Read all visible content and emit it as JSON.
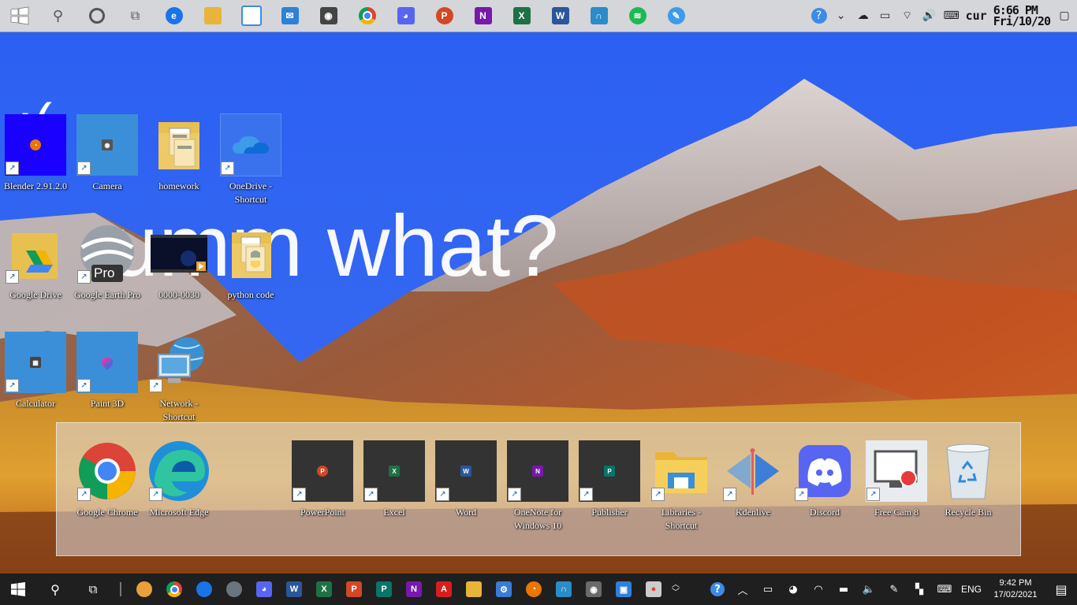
{
  "top_taskbar": {
    "apps": [
      {
        "icon": "windows-start-icon",
        "color": "#ffffff"
      },
      {
        "icon": "search-icon",
        "color": "#555555"
      },
      {
        "icon": "cortana-icon",
        "color": "#555555"
      },
      {
        "icon": "task-view-icon",
        "color": "#555555"
      },
      {
        "icon": "edge-icon",
        "color": "#1a73e8"
      },
      {
        "icon": "file-explorer-icon",
        "color": "#e8b43a"
      },
      {
        "icon": "store-icon",
        "color": "#3a8be8"
      },
      {
        "icon": "mail-icon",
        "color": "#2f80d8"
      },
      {
        "icon": "camera-icon",
        "color": "#444444"
      },
      {
        "icon": "chrome-icon",
        "color": "#db4437"
      },
      {
        "icon": "discord-icon",
        "color": "#5865f2"
      },
      {
        "icon": "powerpoint-icon",
        "color": "#d24726"
      },
      {
        "icon": "onenote-icon",
        "color": "#7719aa"
      },
      {
        "icon": "excel-icon",
        "color": "#1e7145"
      },
      {
        "icon": "word-icon",
        "color": "#2b579a"
      },
      {
        "icon": "terminal-icon",
        "color": "#2a8cc8"
      },
      {
        "icon": "spotify-icon",
        "color": "#1db954"
      },
      {
        "icon": "paint-icon",
        "color": "#3d9be9"
      }
    ],
    "tray_lang": "cur",
    "clock_time": "6:66 PM",
    "clock_date": "Fri/10/20"
  },
  "wallpaper": {
    "sad_face": ":(",
    "message": "umm what?"
  },
  "desktop_icons": [
    {
      "label": "Blender 2.91.2.0",
      "icon": "blender-icon",
      "shortcut": true
    },
    {
      "label": "Camera",
      "icon": "camera-icon",
      "shortcut": true
    },
    {
      "label": "homework",
      "icon": "folder-icon",
      "shortcut": false
    },
    {
      "label": "OneDrive - Shortcut",
      "icon": "onedrive-icon",
      "shortcut": true
    },
    {
      "label": "Google Drive",
      "icon": "google-drive-folder-icon",
      "shortcut": true
    },
    {
      "label": "Google Earth Pro",
      "icon": "google-earth-icon",
      "shortcut": true,
      "badge": "Pro"
    },
    {
      "label": "0000-0030",
      "icon": "video-file-icon",
      "shortcut": false
    },
    {
      "label": "python code",
      "icon": "python-folder-icon",
      "shortcut": false
    },
    {
      "label": "Calculator",
      "icon": "calculator-icon",
      "shortcut": true
    },
    {
      "label": "Paint 3D",
      "icon": "paint3d-icon",
      "shortcut": true
    },
    {
      "label": "Network - Shortcut",
      "icon": "network-icon",
      "shortcut": true
    }
  ],
  "dock_icons": [
    {
      "label": "Google Chrome",
      "icon": "chrome-icon"
    },
    {
      "label": "Microsoft Edge",
      "icon": "edge-icon"
    },
    {
      "label": "PowerPoint",
      "icon": "powerpoint-icon"
    },
    {
      "label": "Excel",
      "icon": "excel-icon"
    },
    {
      "label": "Word",
      "icon": "word-icon"
    },
    {
      "label": "OneNote for Windows 10",
      "icon": "onenote-icon"
    },
    {
      "label": "Publisher",
      "icon": "publisher-icon"
    },
    {
      "label": "Libraries - Shortcut",
      "icon": "libraries-folder-icon"
    },
    {
      "label": "Kdenlive",
      "icon": "kdenlive-icon"
    },
    {
      "label": "Discord",
      "icon": "discord-icon"
    },
    {
      "label": "Free Cam 8",
      "icon": "freecam-icon"
    },
    {
      "label": "Recycle Bin",
      "icon": "recycle-bin-icon"
    }
  ],
  "bottom_taskbar": {
    "apps": [
      {
        "icon": "windows-start-icon"
      },
      {
        "icon": "search-icon"
      },
      {
        "icon": "task-view-icon"
      },
      {
        "icon": "photos-icon",
        "color": "#e8a03a"
      },
      {
        "icon": "chrome-icon",
        "color": "#db4437"
      },
      {
        "icon": "edge-icon",
        "color": "#1a73e8"
      },
      {
        "icon": "google-earth-icon",
        "color": "#6b7580"
      },
      {
        "icon": "discord-icon",
        "color": "#5865f2"
      },
      {
        "icon": "word-icon",
        "color": "#2b579a"
      },
      {
        "icon": "excel-icon",
        "color": "#1e7145"
      },
      {
        "icon": "powerpoint-icon",
        "color": "#d24726"
      },
      {
        "icon": "publisher-icon",
        "color": "#077568"
      },
      {
        "icon": "onenote-icon",
        "color": "#7719aa"
      },
      {
        "icon": "acrobat-icon",
        "color": "#d71e1e"
      },
      {
        "icon": "file-explorer-icon",
        "color": "#e8b43a"
      },
      {
        "icon": "dev-tools-icon",
        "color": "#3a7bd5"
      },
      {
        "icon": "blender-icon",
        "color": "#ea7600"
      },
      {
        "icon": "terminal-icon",
        "color": "#2a8cc8"
      },
      {
        "icon": "camera-icon",
        "color": "#6a6a6a"
      },
      {
        "icon": "remote-desktop-icon",
        "color": "#2f80d8"
      },
      {
        "icon": "freecam-icon",
        "color": "#cccccc"
      }
    ],
    "lang": "ENG",
    "clock_time": "9:42 PM",
    "clock_date": "17/02/2021"
  }
}
